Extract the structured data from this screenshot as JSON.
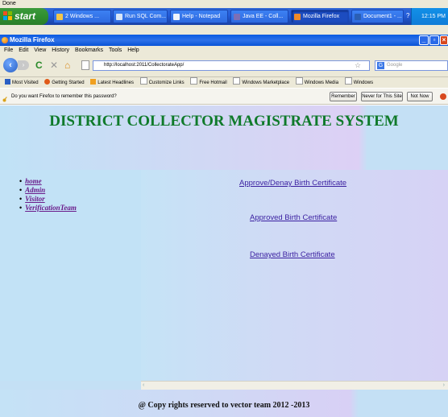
{
  "status_top": "Done",
  "taskbar": {
    "start_label": "start",
    "tasks": [
      {
        "label": "2 Windows ...",
        "color": "#f3c64a"
      },
      {
        "label": "Run SQL Com...",
        "color": "#d9e6f7"
      },
      {
        "label": "Help - Notepad",
        "color": "#eef3fb"
      },
      {
        "label": "Java EE - Coll...",
        "color": "#7c6fb6"
      },
      {
        "label": "Mozilla Firefox",
        "color": "#f08a2a"
      },
      {
        "label": "Document1 - ...",
        "color": "#2b5fb4"
      }
    ],
    "clock": "12:15 PM"
  },
  "browser": {
    "window_title": "Mozilla Firefox",
    "menu": [
      "File",
      "Edit",
      "View",
      "History",
      "Bookmarks",
      "Tools",
      "Help"
    ],
    "url": "http://localhost:2011/CollectorateApp/",
    "search_placeholder": "Google",
    "bookmarks": [
      {
        "label": "Most Visited",
        "color": "#2a5fc4"
      },
      {
        "label": "Getting Started",
        "color": "#e05a1a"
      },
      {
        "label": "Latest Headlines",
        "color": "#f0a020"
      },
      {
        "label": "Customize Links",
        "color": "#ffffff"
      },
      {
        "label": "Free Hotmail",
        "color": "#ffffff"
      },
      {
        "label": "Windows Marketplace",
        "color": "#ffffff"
      },
      {
        "label": "Windows Media",
        "color": "#ffffff"
      },
      {
        "label": "Windows",
        "color": "#ffffff"
      }
    ],
    "notification": {
      "text": "Do you want Firefox to remember this password?",
      "remember": "Remember",
      "never": "Never for This Site",
      "not_now": "Not Now"
    }
  },
  "page": {
    "title": "DISTRICT COLLECTOR MAGISTRATE SYSTEM",
    "nav": [
      "home",
      "Admin",
      "Visitor",
      "VerificationTeam"
    ],
    "links": [
      "Approve/Denay Birth Certificate",
      "Approved Birth Certificate",
      "Denayed Birth Certificate"
    ],
    "footer": "@ Copy rights reserved to vector team 2012 -2013"
  },
  "colors": {
    "title_green": "#0f7a2a",
    "nav_purple": "#6a1b8a",
    "link_blue": "#3a1fa0"
  }
}
